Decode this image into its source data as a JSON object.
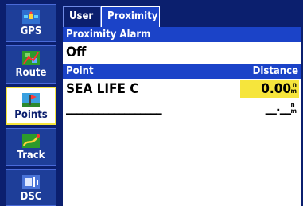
{
  "sidebar": {
    "items": [
      {
        "label": "GPS",
        "icon": "satellite-icon",
        "selected": false
      },
      {
        "label": "Route",
        "icon": "route-map-icon",
        "selected": false
      },
      {
        "label": "Points",
        "icon": "waypoint-flag-icon",
        "selected": true
      },
      {
        "label": "Track",
        "icon": "track-path-icon",
        "selected": false
      },
      {
        "label": "DSC",
        "icon": "radio-call-icon",
        "selected": false
      }
    ]
  },
  "tabs": [
    {
      "label": "User",
      "active": false
    },
    {
      "label": "Proximity",
      "active": true
    }
  ],
  "proximity_alarm": {
    "header": "Proximity Alarm",
    "value": "Off"
  },
  "table": {
    "col_point": "Point",
    "col_distance": "Distance",
    "rows": [
      {
        "point": "SEA LIFE C",
        "distance": "0.00",
        "unit_top": "n",
        "unit_bottom": "m"
      },
      {
        "point": "__________________",
        "distance": "__.__",
        "unit_top": "n",
        "unit_bottom": "m"
      }
    ]
  },
  "colors": {
    "frame": "#0b1f6e",
    "header_band": "#1b43c8",
    "highlight": "#f6e53c",
    "background": "#ffffff"
  }
}
